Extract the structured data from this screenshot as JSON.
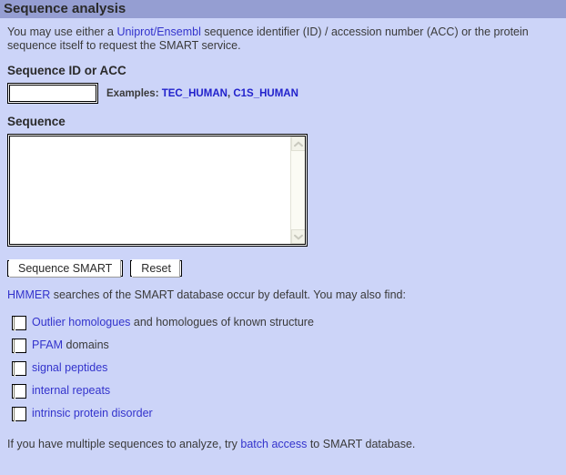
{
  "header": {
    "title": "Sequence analysis",
    "bar_color": "#959ED2",
    "page_bg": "#CCD4F8"
  },
  "intro": {
    "text_before_link": "You may use either a ",
    "link_label": "Uniprot/Ensembl",
    "text_after_link": " sequence identifier (ID) / accession number (ACC) or the protein sequence itself to request the SMART service."
  },
  "id_section": {
    "title": "Sequence ID or ACC",
    "input_value": "",
    "input_placeholder": "",
    "examples_label": "Examples:",
    "examples": [
      {
        "label": "TEC_HUMAN"
      },
      {
        "label": "C1S_HUMAN"
      }
    ],
    "examples_separator": ", "
  },
  "sequence_section": {
    "title": "Sequence",
    "textarea_value": "",
    "textarea_placeholder": "",
    "scroll_up_icon": "chevron-up-icon",
    "scroll_down_icon": "chevron-down-icon"
  },
  "buttons": {
    "submit_label": "Sequence SMART",
    "reset_label": "Reset"
  },
  "note": {
    "link_label": "HMMER",
    "text_after_link": " searches of the SMART database occur by default. You may also find:"
  },
  "options": [
    {
      "name": "outlier-homologues",
      "checked": false,
      "link_label": "Outlier homologues",
      "text_after_link": " and homologues of known structure"
    },
    {
      "name": "pfam-domains",
      "checked": false,
      "link_label": "PFAM",
      "text_after_link": " domains"
    },
    {
      "name": "signal-peptides",
      "checked": false,
      "link_label": "signal peptides",
      "text_after_link": ""
    },
    {
      "name": "internal-repeats",
      "checked": false,
      "link_label": "internal repeats",
      "text_after_link": ""
    },
    {
      "name": "intrinsic-protein-disorder",
      "checked": false,
      "link_label": "intrinsic protein disorder",
      "text_after_link": ""
    }
  ],
  "footer": {
    "text_before_link": "If you have multiple sequences to analyze, try ",
    "link_label": "batch access",
    "text_after_link": " to SMART database."
  },
  "colors": {
    "link": "#3333CC",
    "link_bold": "#2222CC",
    "text": "#3A3A3A"
  }
}
